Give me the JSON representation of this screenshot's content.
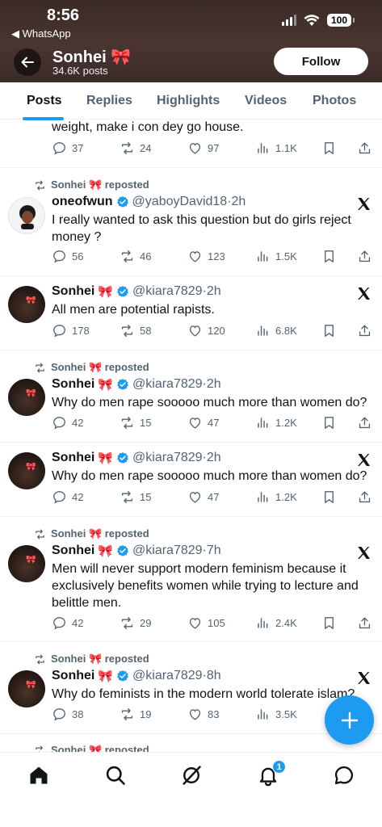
{
  "status_bar": {
    "time": "8:56",
    "back_app": "◀ WhatsApp",
    "battery": "100"
  },
  "profile": {
    "name": "Sonhei",
    "name_emoji": "🎀",
    "posts_count": "34.6K posts",
    "follow_label": "Follow"
  },
  "tabs": [
    {
      "label": "Posts",
      "active": true
    },
    {
      "label": "Replies",
      "active": false
    },
    {
      "label": "Highlights",
      "active": false
    },
    {
      "label": "Videos",
      "active": false
    },
    {
      "label": "Photos",
      "active": false
    }
  ],
  "repost_label": "Sonhei 🎀 reposted",
  "tweets": [
    {
      "text": "weight, make i con dey go house.",
      "replies": "37",
      "reposts": "24",
      "likes": "97",
      "views": "1.1K"
    },
    {
      "reposted": true,
      "name": "oneofwun",
      "emoji": "",
      "verified": true,
      "handle": "@yaboyDavid18",
      "time": "2h",
      "text": "I really wanted to ask this question but do girls reject money ?",
      "replies": "56",
      "reposts": "46",
      "likes": "123",
      "views": "1.5K"
    },
    {
      "reposted": false,
      "name": "Sonhei",
      "emoji": "🎀",
      "verified": true,
      "handle": "@kiara7829",
      "time": "2h",
      "text": "All men are potential rapists.",
      "replies": "178",
      "reposts": "58",
      "likes": "120",
      "views": "6.8K"
    },
    {
      "reposted": true,
      "name": "Sonhei",
      "emoji": "🎀",
      "verified": true,
      "handle": "@kiara7829",
      "time": "2h",
      "text": "Why do men rape sooooo much more than women do?",
      "replies": "42",
      "reposts": "15",
      "likes": "47",
      "views": "1.2K"
    },
    {
      "reposted": false,
      "name": "Sonhei",
      "emoji": "🎀",
      "verified": true,
      "handle": "@kiara7829",
      "time": "2h",
      "text": "Why do men rape sooooo much more than women do?",
      "replies": "42",
      "reposts": "15",
      "likes": "47",
      "views": "1.2K"
    },
    {
      "reposted": true,
      "name": "Sonhei",
      "emoji": "🎀",
      "verified": true,
      "handle": "@kiara7829",
      "time": "7h",
      "text": "Men will never support modern feminism because it exclusively benefits women while trying to lecture and belittle men.",
      "replies": "42",
      "reposts": "29",
      "likes": "105",
      "views": "2.4K"
    },
    {
      "reposted": true,
      "name": "Sonhei",
      "emoji": "🎀",
      "verified": true,
      "handle": "@kiara7829",
      "time": "8h",
      "text": "Why do feminists in the modern world tolerate islam?",
      "replies": "38",
      "reposts": "19",
      "likes": "83",
      "views": "3.5K"
    }
  ],
  "bottom_nav": {
    "icons": [
      "home-icon",
      "search-icon",
      "grok-icon",
      "bell-icon",
      "messages-icon"
    ],
    "notification_count": "1"
  },
  "colors": {
    "accent": "#1d9bf0",
    "muted_text": "#536471",
    "header_bg": "#3f2e2a"
  }
}
